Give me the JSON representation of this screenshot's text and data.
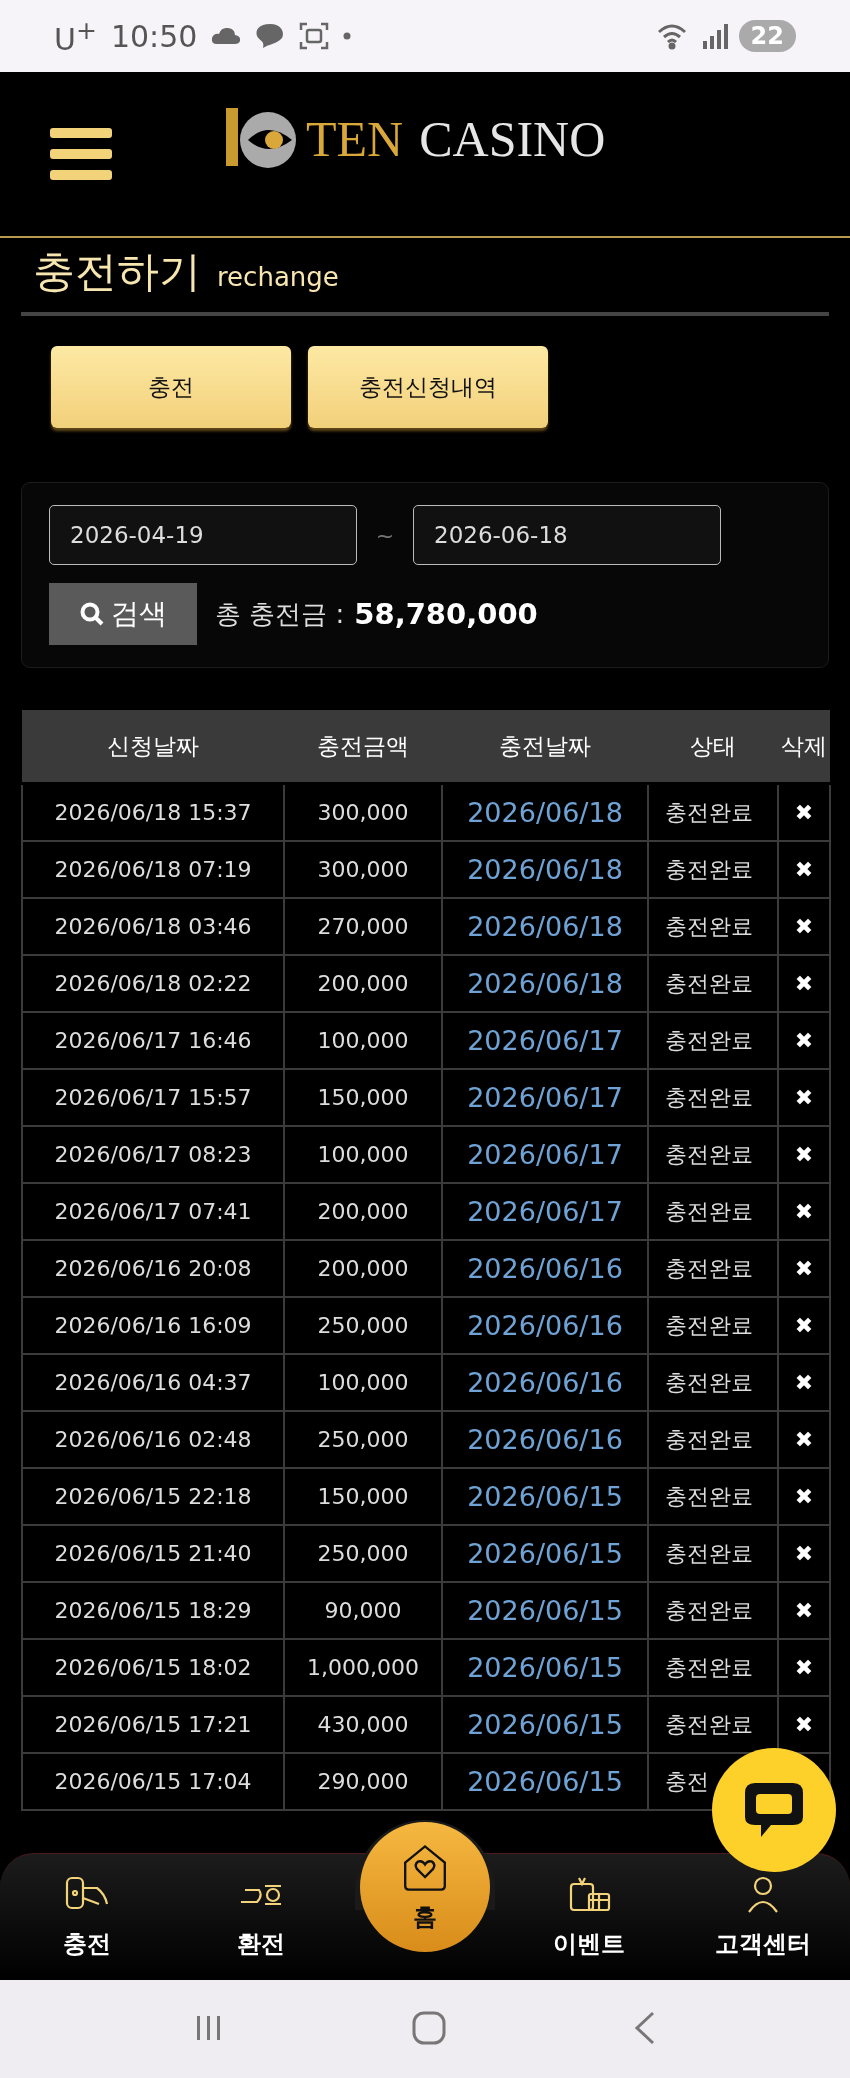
{
  "status_bar": {
    "carrier": "U$^{+}$",
    "time": "10:50",
    "battery": "22"
  },
  "header": {
    "logo": {
      "word_1": "TEN",
      "word_2": "CASINO"
    }
  },
  "page_title": {
    "title": "충전하기",
    "subtitle": "rechange"
  },
  "tabs": [
    {
      "label": "충전"
    },
    {
      "label": "충전신청내역"
    }
  ],
  "filter": {
    "date_from": "2026-04-19",
    "separator": "~",
    "date_to": "2026-06-18",
    "search_button": "검색",
    "total_label": "총 충전금 :",
    "total_amount": "58,780,000"
  },
  "table": {
    "columns": [
      "신청날짜",
      "충전금액",
      "충전날짜",
      "상태",
      "삭제"
    ],
    "rows": [
      {
        "requested": "2026/06/18 15:37",
        "amount": "300,000",
        "charged": "2026/06/18",
        "status": "충전완료",
        "delete": "✖"
      },
      {
        "requested": "2026/06/18 07:19",
        "amount": "300,000",
        "charged": "2026/06/18",
        "status": "충전완료",
        "delete": "✖"
      },
      {
        "requested": "2026/06/18 03:46",
        "amount": "270,000",
        "charged": "2026/06/18",
        "status": "충전완료",
        "delete": "✖"
      },
      {
        "requested": "2026/06/18 02:22",
        "amount": "200,000",
        "charged": "2026/06/18",
        "status": "충전완료",
        "delete": "✖"
      },
      {
        "requested": "2026/06/17 16:46",
        "amount": "100,000",
        "charged": "2026/06/17",
        "status": "충전완료",
        "delete": "✖"
      },
      {
        "requested": "2026/06/17 15:57",
        "amount": "150,000",
        "charged": "2026/06/17",
        "status": "충전완료",
        "delete": "✖"
      },
      {
        "requested": "2026/06/17 08:23",
        "amount": "100,000",
        "charged": "2026/06/17",
        "status": "충전완료",
        "delete": "✖"
      },
      {
        "requested": "2026/06/17 07:41",
        "amount": "200,000",
        "charged": "2026/06/17",
        "status": "충전완료",
        "delete": "✖"
      },
      {
        "requested": "2026/06/16 20:08",
        "amount": "200,000",
        "charged": "2026/06/16",
        "status": "충전완료",
        "delete": "✖"
      },
      {
        "requested": "2026/06/16 16:09",
        "amount": "250,000",
        "charged": "2026/06/16",
        "status": "충전완료",
        "delete": "✖"
      },
      {
        "requested": "2026/06/16 04:37",
        "amount": "100,000",
        "charged": "2026/06/16",
        "status": "충전완료",
        "delete": "✖"
      },
      {
        "requested": "2026/06/16 02:48",
        "amount": "250,000",
        "charged": "2026/06/16",
        "status": "충전완료",
        "delete": "✖"
      },
      {
        "requested": "2026/06/15 22:18",
        "amount": "150,000",
        "charged": "2026/06/15",
        "status": "충전완료",
        "delete": "✖"
      },
      {
        "requested": "2026/06/15 21:40",
        "amount": "250,000",
        "charged": "2026/06/15",
        "status": "충전완료",
        "delete": "✖"
      },
      {
        "requested": "2026/06/15 18:29",
        "amount": "90,000",
        "charged": "2026/06/15",
        "status": "충전완료",
        "delete": "✖"
      },
      {
        "requested": "2026/06/15 18:02",
        "amount": "1,000,000",
        "charged": "2026/06/15",
        "status": "충전완료",
        "delete": "✖"
      },
      {
        "requested": "2026/06/15 17:21",
        "amount": "430,000",
        "charged": "2026/06/15",
        "status": "충전완료",
        "delete": "✖"
      },
      {
        "requested": "2026/06/15 17:04",
        "amount": "290,000",
        "charged": "2026/06/15",
        "status": "충전"
      }
    ]
  },
  "bottom_nav": [
    {
      "label": "충전",
      "kind": "deposit"
    },
    {
      "label": "환전",
      "kind": "withdraw"
    },
    {
      "label": "홈",
      "kind": "home"
    },
    {
      "label": "이벤트",
      "kind": "event"
    },
    {
      "label": "고객센터",
      "kind": "support"
    }
  ]
}
